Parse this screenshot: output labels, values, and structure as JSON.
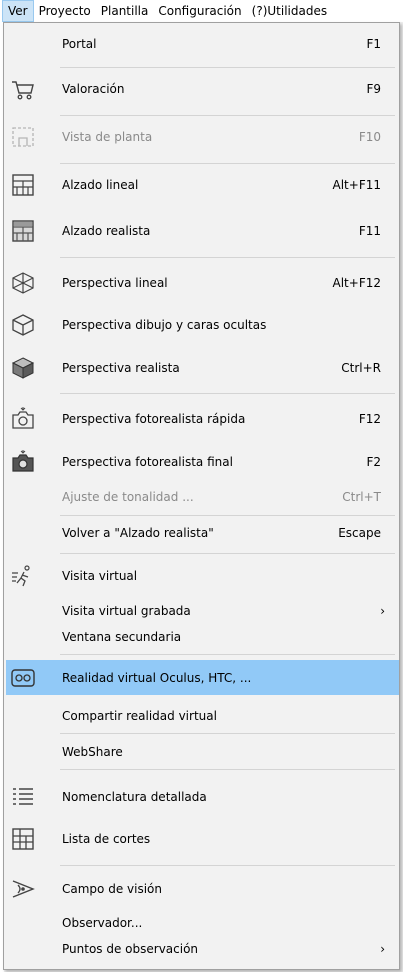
{
  "menubar": {
    "items": [
      "Ver",
      "Proyecto",
      "Plantilla",
      "Configuración",
      "(?)Utilidades"
    ]
  },
  "menu": {
    "items": [
      {
        "label": "Portal",
        "shortcut": "F1"
      },
      {
        "label": "Valoración",
        "shortcut": "F9",
        "icon": "cart-icon"
      },
      {
        "label": "Vista de planta",
        "shortcut": "F10",
        "icon": "floor-plan-icon",
        "disabled": true
      },
      {
        "label": "Alzado lineal",
        "shortcut": "Alt+F11",
        "icon": "elevation-line-icon"
      },
      {
        "label": "Alzado realista",
        "shortcut": "F11",
        "icon": "elevation-realistic-icon"
      },
      {
        "label": "Perspectiva lineal",
        "shortcut": "Alt+F12",
        "icon": "cube-wireframe-icon"
      },
      {
        "label": "Perspectiva dibujo y caras ocultas",
        "shortcut": "",
        "icon": "cube-outline-icon"
      },
      {
        "label": "Perspectiva realista",
        "shortcut": "Ctrl+R",
        "icon": "cube-solid-icon"
      },
      {
        "label": "Perspectiva fotorealista rápida",
        "shortcut": "F12",
        "icon": "camera-outline-icon"
      },
      {
        "label": "Perspectiva fotorealista final",
        "shortcut": "F2",
        "icon": "camera-solid-icon"
      },
      {
        "label": "Ajuste de tonalidad ...",
        "shortcut": "Ctrl+T",
        "disabled": true
      },
      {
        "label": "Volver a \"Alzado realista\"",
        "shortcut": "Escape"
      },
      {
        "label": "Visita virtual",
        "shortcut": "",
        "icon": "walking-person-icon"
      },
      {
        "label": "Visita virtual grabada",
        "shortcut": "",
        "submenu": true
      },
      {
        "label": "Ventana secundaria",
        "shortcut": ""
      },
      {
        "label": "Realidad virtual Oculus, HTC, ...",
        "shortcut": "",
        "icon": "vr-headset-icon",
        "highlighted": true
      },
      {
        "label": "Compartir realidad virtual",
        "shortcut": ""
      },
      {
        "label": "WebShare",
        "shortcut": ""
      },
      {
        "label": "Nomenclatura detallada",
        "shortcut": "",
        "icon": "list-icon"
      },
      {
        "label": "Lista de cortes",
        "shortcut": "",
        "icon": "cut-list-icon"
      },
      {
        "label": "Campo de visión",
        "shortcut": "",
        "icon": "field-of-view-icon"
      },
      {
        "label": "Observador...",
        "shortcut": ""
      },
      {
        "label": "Puntos de observación",
        "shortcut": "",
        "submenu": true
      }
    ],
    "submenu_arrow": "›"
  },
  "colors": {
    "highlight": "#91c9f7",
    "menu_bg": "#f2f2f2",
    "disabled_text": "#8a8a8a"
  }
}
